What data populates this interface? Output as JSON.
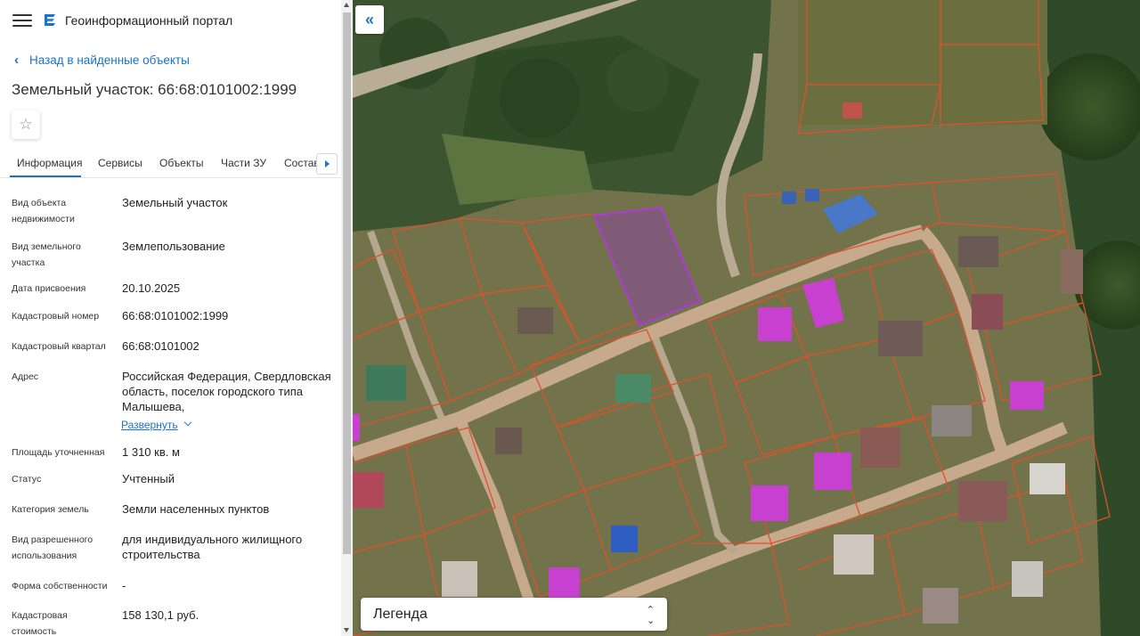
{
  "header": {
    "app_title": "Геоинформационный портал"
  },
  "back_link": "Назад в найденные объекты",
  "object_title": "Земельный участок: 66:68:0101002:1999",
  "tabs": [
    {
      "label": "Информация",
      "active": true
    },
    {
      "label": "Сервисы"
    },
    {
      "label": "Объекты"
    },
    {
      "label": "Части ЗУ"
    },
    {
      "label": "Состав"
    }
  ],
  "fields": [
    {
      "label": "Вид объекта недвижимости",
      "value": "Земельный участок"
    },
    {
      "label": "Вид земельного участка",
      "value": "Землепользование"
    },
    {
      "label": "Дата присвоения",
      "value": "20.10.2025"
    },
    {
      "label": "Кадастровый номер",
      "value": "66:68:0101002:1999"
    },
    {
      "label": "Кадастровый квартал",
      "value": "66:68:0101002"
    },
    {
      "label": "Адрес",
      "value": "Российская Федерация, Свердловская область, поселок городского типа Малышева,"
    },
    {
      "label": "Площадь уточненная",
      "value": "1 310 кв. м"
    },
    {
      "label": "Статус",
      "value": "Учтенный"
    },
    {
      "label": "Категория земель",
      "value": "Земли населенных пунктов"
    },
    {
      "label": "Вид разрешенного использования",
      "value": "для индивидуального жилищного строительства"
    },
    {
      "label": "Форма собственности",
      "value": "-"
    },
    {
      "label": "Кадастровая стоимость",
      "value": "158 130,1 руб."
    }
  ],
  "expand_link": "Развернуть",
  "map": {
    "collapse_icon": "«",
    "legend_label": "Легенда",
    "colors": {
      "accent": "#1a73c8",
      "parcel_border": "#e0502a",
      "selected_parcel": "#b03ad8"
    }
  }
}
